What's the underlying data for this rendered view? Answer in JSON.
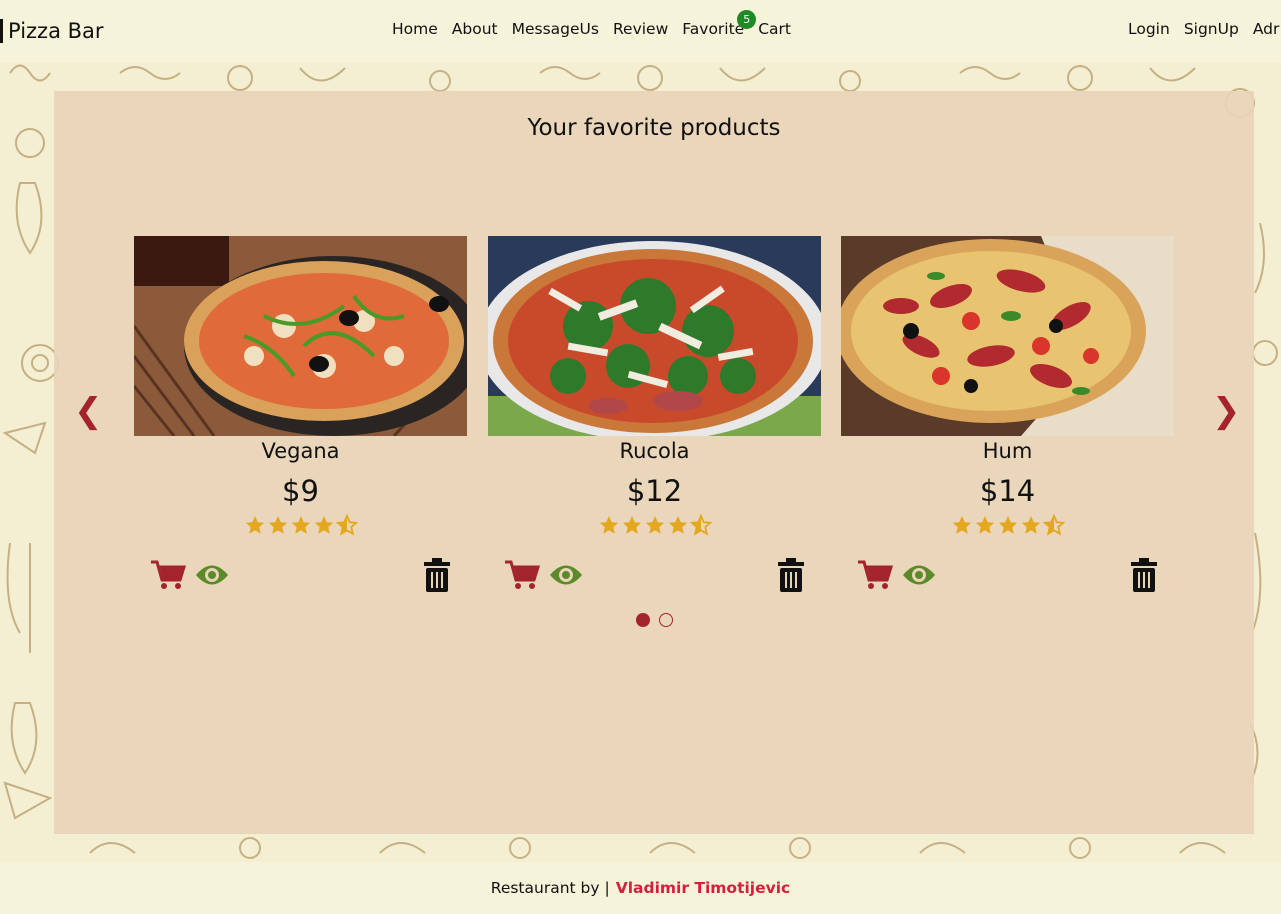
{
  "nav": {
    "brand": "Pizza Bar",
    "links": [
      "Home",
      "About",
      "MessageUs",
      "Review",
      "Favorite",
      "Cart"
    ],
    "favorite_count": "5",
    "right_links": [
      "Login",
      "SignUp",
      "Adr"
    ]
  },
  "main": {
    "title": "Your favorite products",
    "prev_arrow": "❮",
    "next_arrow": "❯",
    "products": [
      {
        "name": "Vegana",
        "price": "$9",
        "rating": 4.5
      },
      {
        "name": "Rucola",
        "price": "$12",
        "rating": 4.5
      },
      {
        "name": "Hum",
        "price": "$14",
        "rating": 4.5
      }
    ],
    "active_slide": 1,
    "slide_count": 2
  },
  "footer": {
    "text": "Restaurant by |",
    "author": "Vladimir Timotijevic"
  },
  "colors": {
    "accent": "#a4242b",
    "star": "#e4a820",
    "eye": "#5c8a2a",
    "badge": "#1e8a23",
    "footer_link": "#d61f3e"
  }
}
